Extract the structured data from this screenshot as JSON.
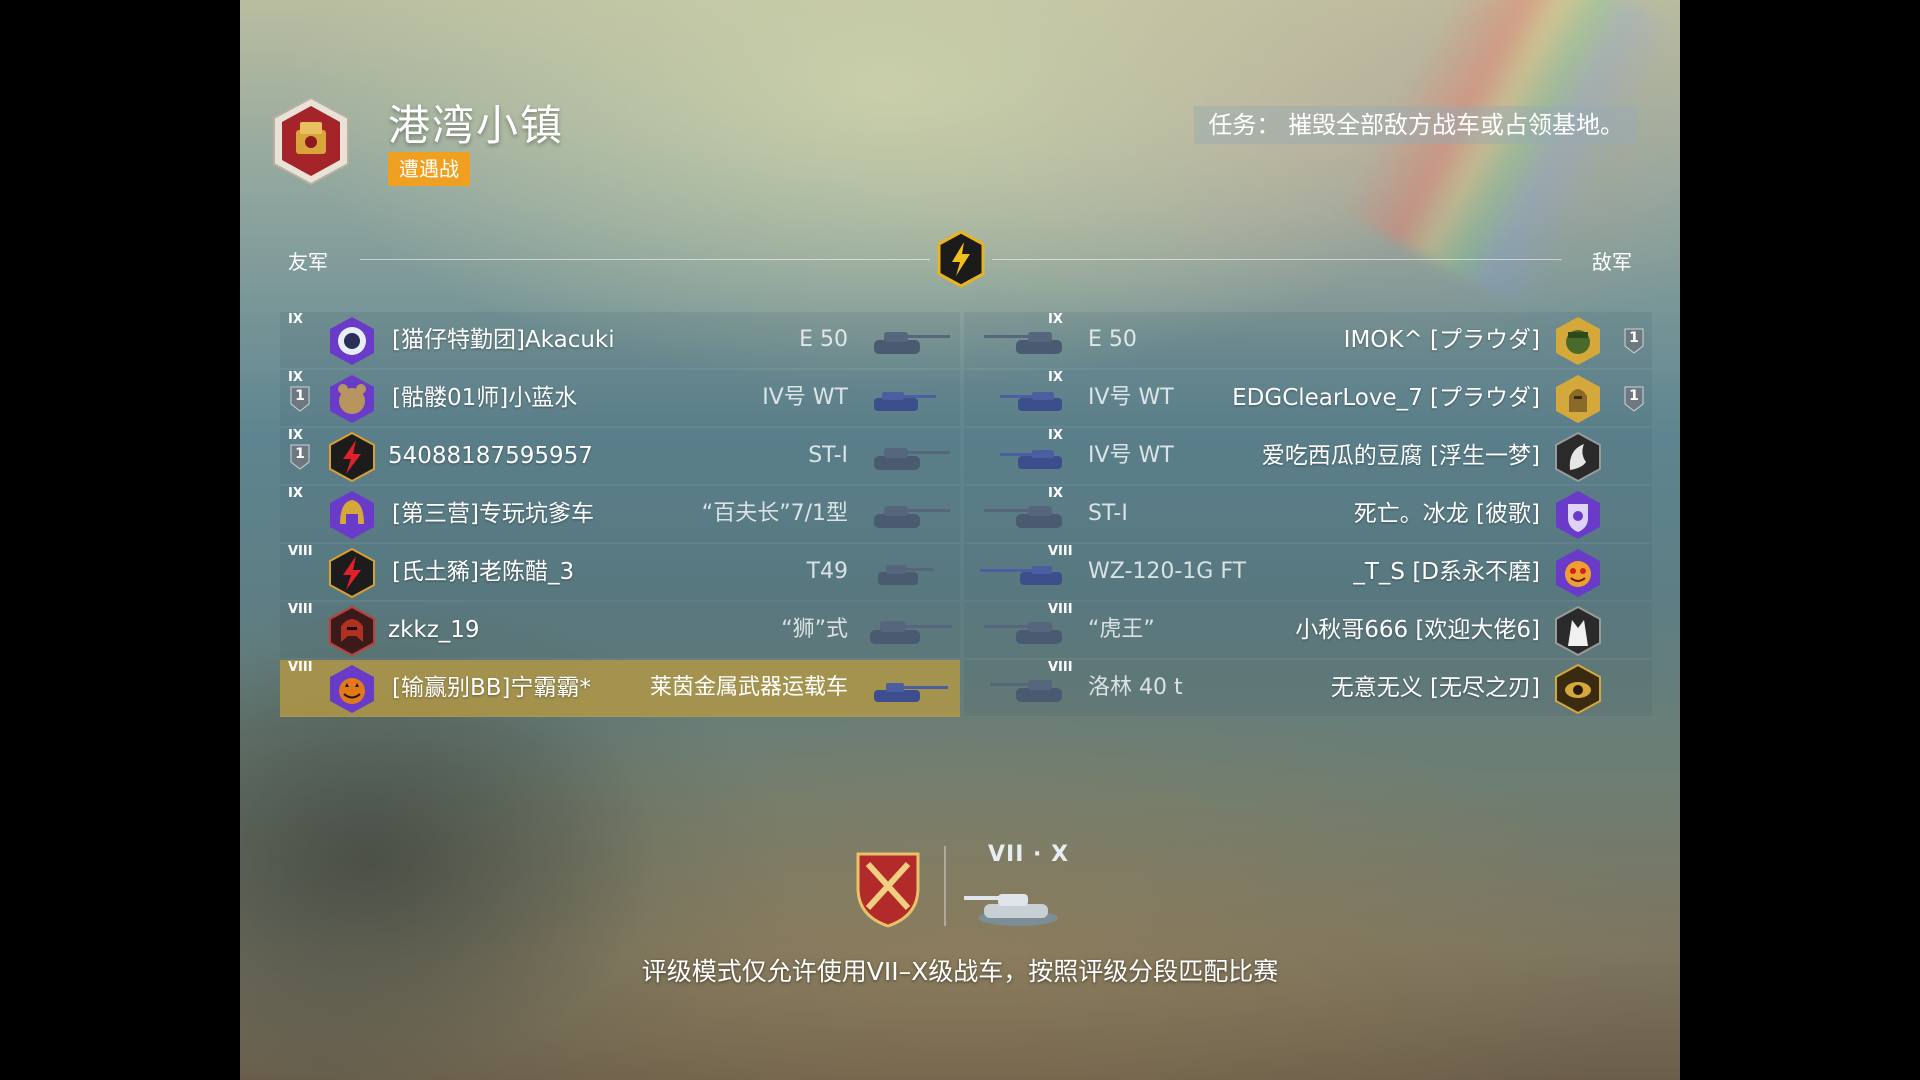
{
  "header": {
    "map_title": "港湾小镇",
    "battle_type": "遭遇战",
    "mission": "任务：  摧毁全部敌方战车或占领基地。"
  },
  "teams": {
    "allies_label": "友军",
    "enemies_label": "敌军"
  },
  "allies": [
    {
      "player": "[猫仔特勤团]Akacuki",
      "tank": "E 50",
      "tier": "IX",
      "platoon": "",
      "avatar": "astronaut-avatar-icon",
      "highlight": false
    },
    {
      "player": "[骷髅01师]小蓝水",
      "tank": "IV号 WT",
      "tier": "IX",
      "platoon": "1",
      "avatar": "bear-avatar-icon",
      "highlight": false
    },
    {
      "player": "54088187595957",
      "tank": "ST-I",
      "tier": "IX",
      "platoon": "1",
      "avatar": "lightning-avatar-icon",
      "highlight": false
    },
    {
      "player": "[第三营]专玩坑爹车",
      "tank": "“百夫长”7/1型",
      "tier": "IX",
      "platoon": "",
      "avatar": "spartan-helmet-avatar-icon",
      "highlight": false
    },
    {
      "player": "[氏土豨]老陈醋_3",
      "tank": "T49",
      "tier": "VIII",
      "platoon": "",
      "avatar": "lightning-avatar-icon",
      "highlight": false
    },
    {
      "player": "zkkz_19",
      "tank": "“狮”式",
      "tier": "VIII",
      "platoon": "",
      "avatar": "knight-helmet-avatar-icon",
      "highlight": false
    },
    {
      "player": "[输赢别BB]宁霸霸*",
      "tank": "莱茵金属武器运载车",
      "tier": "VIII",
      "platoon": "",
      "avatar": "pumpkin-avatar-icon",
      "highlight": true
    }
  ],
  "enemies": [
    {
      "player": "IMOK^ [プラウダ]",
      "tank": "E 50",
      "tier": "IX",
      "platoon": "1",
      "avatar": "soldier-avatar-icon"
    },
    {
      "player": "EDGClearLove_7 [プラウダ]",
      "tank": "IV号 WT",
      "tier": "IX",
      "platoon": "1",
      "avatar": "knight-avatar-icon"
    },
    {
      "player": "爱吃西瓜的豆腐 [浮生一梦]",
      "tank": "IV号 WT",
      "tier": "IX",
      "platoon": "",
      "avatar": "raven-avatar-icon"
    },
    {
      "player": "死亡。冰龙 [彼歌]",
      "tank": "ST-I",
      "tier": "IX",
      "platoon": "",
      "avatar": "crest-avatar-icon"
    },
    {
      "player": "_T_S [D系永不磨]",
      "tank": "WZ-120-1G FT",
      "tier": "VIII",
      "platoon": "",
      "avatar": "smiley-avatar-icon"
    },
    {
      "player": "小秋哥666 [欢迎大佬6]",
      "tank": "“虎王”",
      "tier": "VIII",
      "platoon": "",
      "avatar": "wolf-avatar-icon"
    },
    {
      "player": "无意无义 [无尽之刃]",
      "tank": "洛林 40 t",
      "tier": "VIII",
      "platoon": "",
      "avatar": "eye-avatar-icon"
    }
  ],
  "footer": {
    "tier_range": "VII · X",
    "description": "评级模式仅允许使用VII–X级战车，按照评级分段匹配比赛"
  },
  "colors": {
    "battle_type_bg": "#f0a020",
    "highlight_row": "#b0964a",
    "avatar_purple": "#7a3fd0",
    "avatar_gold": "#d4a83a"
  }
}
